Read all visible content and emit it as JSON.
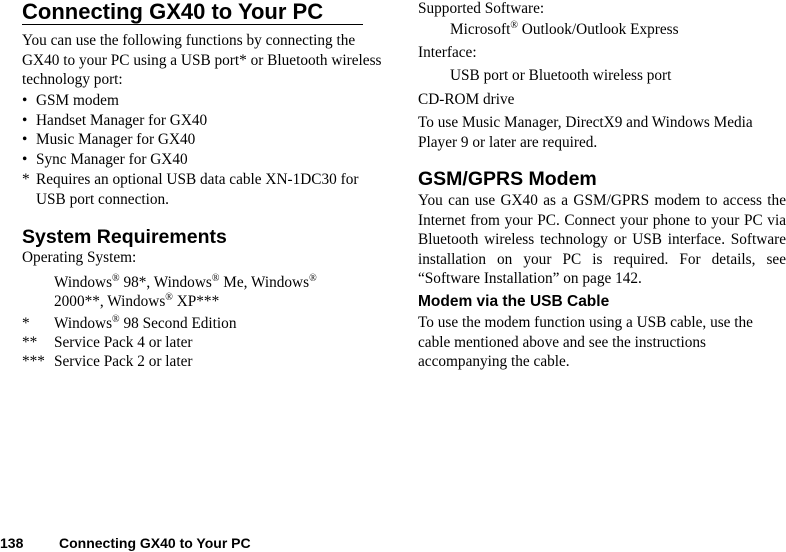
{
  "left_column": {
    "title": "Connecting GX40 to Your PC",
    "intro": "You can use the following functions by connecting the GX40 to your PC using a USB port* or Bluetooth wireless technology port:",
    "bullets": [
      {
        "mark": "•",
        "text": "GSM modem"
      },
      {
        "mark": "•",
        "text": "Handset Manager for GX40"
      },
      {
        "mark": "•",
        "text": "Music Manager for GX40"
      },
      {
        "mark": "•",
        "text": "Sync Manager for GX40"
      }
    ],
    "note": {
      "mark": "*",
      "text": "Requires an optional USB data cable XN-1DC30 for USB port connection."
    },
    "system_requirements": {
      "heading": "System Requirements",
      "os_label": "Operating System:",
      "os_line1": {
        "w1": "Windows",
        "p1": " 98*, ",
        "w2": "Windows",
        "p2": " Me, ",
        "w3": "Windows",
        "p3": ""
      },
      "os_line2": {
        "p0": "2000**, ",
        "w4": "Windows",
        "p4": " XP***"
      },
      "reg_mark": "®",
      "footnotes": [
        {
          "mark": "*",
          "pre": "Windows",
          "post": " 98 Second Edition",
          "has_reg": true
        },
        {
          "mark": "**",
          "pre": "Service Pack 4 or later",
          "post": "",
          "has_reg": false
        },
        {
          "mark": "***",
          "pre": "Service Pack 2 or later",
          "post": "",
          "has_reg": false
        }
      ]
    }
  },
  "right_column": {
    "supported_software_label": "Supported Software:",
    "supported_software_value_pre": "Microsoft",
    "supported_software_value_post": " Outlook/Outlook Express",
    "interface_label": "Interface:",
    "interface_value": "USB port or Bluetooth wireless port",
    "cdrom": "CD-ROM drive",
    "music_manager_note": "To use Music Manager, DirectX9 and Windows Media Player 9 or later are required.",
    "gsm_heading": "GSM/GPRS Modem",
    "gsm_text": "You can use GX40 as a GSM/GPRS modem to access the Internet from your PC. Connect your phone to your PC via Bluetooth wireless technology or USB interface. Software installation on your PC is required. For details, see “Software Installation” on page 142.",
    "usb_heading": "Modem via the USB Cable",
    "usb_text": "To use the modem function using a USB cable, use the cable mentioned above and see the instructions accompanying the cable."
  },
  "footer": {
    "page_number": "138",
    "title": "Connecting GX40 to Your PC"
  }
}
